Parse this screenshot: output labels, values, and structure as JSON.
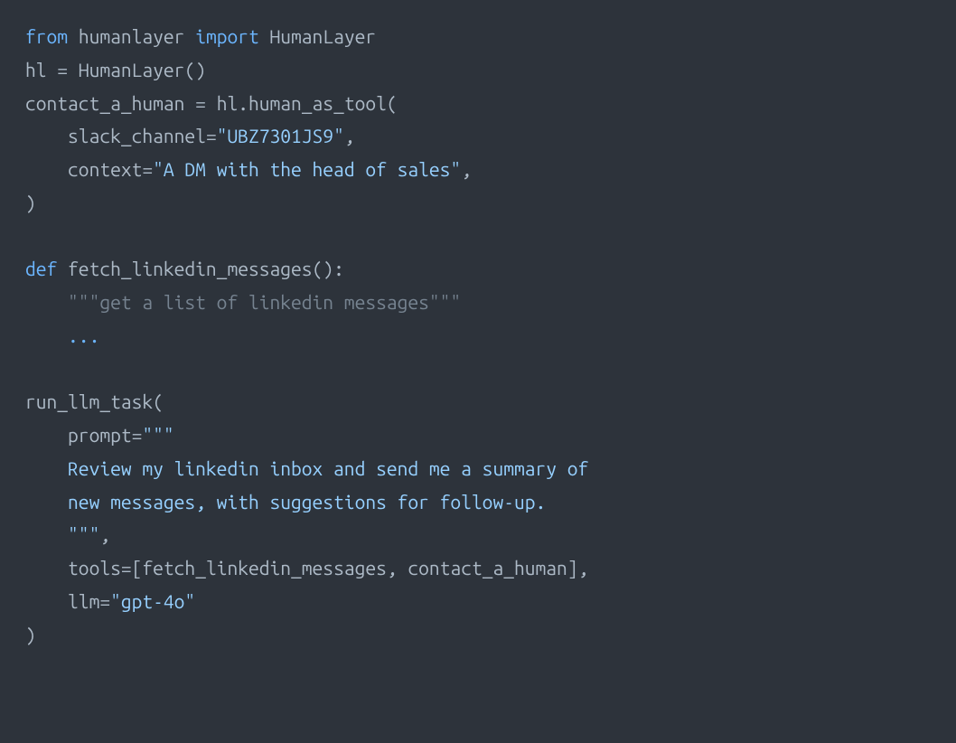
{
  "code": {
    "line1": {
      "from_kw": "from",
      "module": "humanlayer",
      "import_kw": "import",
      "class": "HumanLayer"
    },
    "line2": {
      "var": "hl",
      "assign": " = ",
      "call": "HumanLayer()"
    },
    "line3": {
      "var": "contact_a_human",
      "assign": " = ",
      "obj": "hl",
      "dot": ".",
      "method": "human_as_tool",
      "open": "("
    },
    "line4": {
      "indent": "    ",
      "kwarg": "slack_channel",
      "eq": "=",
      "value": "\"UBZ7301JS9\"",
      "comma": ","
    },
    "line5": {
      "indent": "    ",
      "kwarg": "context",
      "eq": "=",
      "value": "\"A DM with the head of sales\"",
      "comma": ","
    },
    "line6": {
      "close": ")"
    },
    "line8": {
      "def_kw": "def",
      "space": " ",
      "name": "fetch_linkedin_messages",
      "parens": "()",
      "colon": ":"
    },
    "line9": {
      "indent": "    ",
      "docstring": "\"\"\"get a list of linkedin messages\"\"\""
    },
    "line10": {
      "indent": "    ",
      "ellipsis": "..."
    },
    "line12": {
      "call": "run_llm_task",
      "open": "("
    },
    "line13": {
      "indent": "    ",
      "kwarg": "prompt",
      "eq": "=",
      "triple_open": "\"\"\""
    },
    "line14": {
      "indent": "    ",
      "text": "Review my linkedin inbox and send me a summary of"
    },
    "line15": {
      "indent": "    ",
      "text": "new messages, with suggestions for follow-up."
    },
    "line16": {
      "indent": "    ",
      "triple_close": "\"\"\"",
      "comma": ","
    },
    "line17": {
      "indent": "    ",
      "kwarg": "tools",
      "eq": "=",
      "open_bracket": "[",
      "item1": "fetch_linkedin_messages",
      "comma1": ", ",
      "item2": "contact_a_human",
      "close_bracket": "]",
      "comma": ","
    },
    "line18": {
      "indent": "    ",
      "kwarg": "llm",
      "eq": "=",
      "value": "\"gpt-4o\""
    },
    "line19": {
      "close": ")"
    }
  }
}
